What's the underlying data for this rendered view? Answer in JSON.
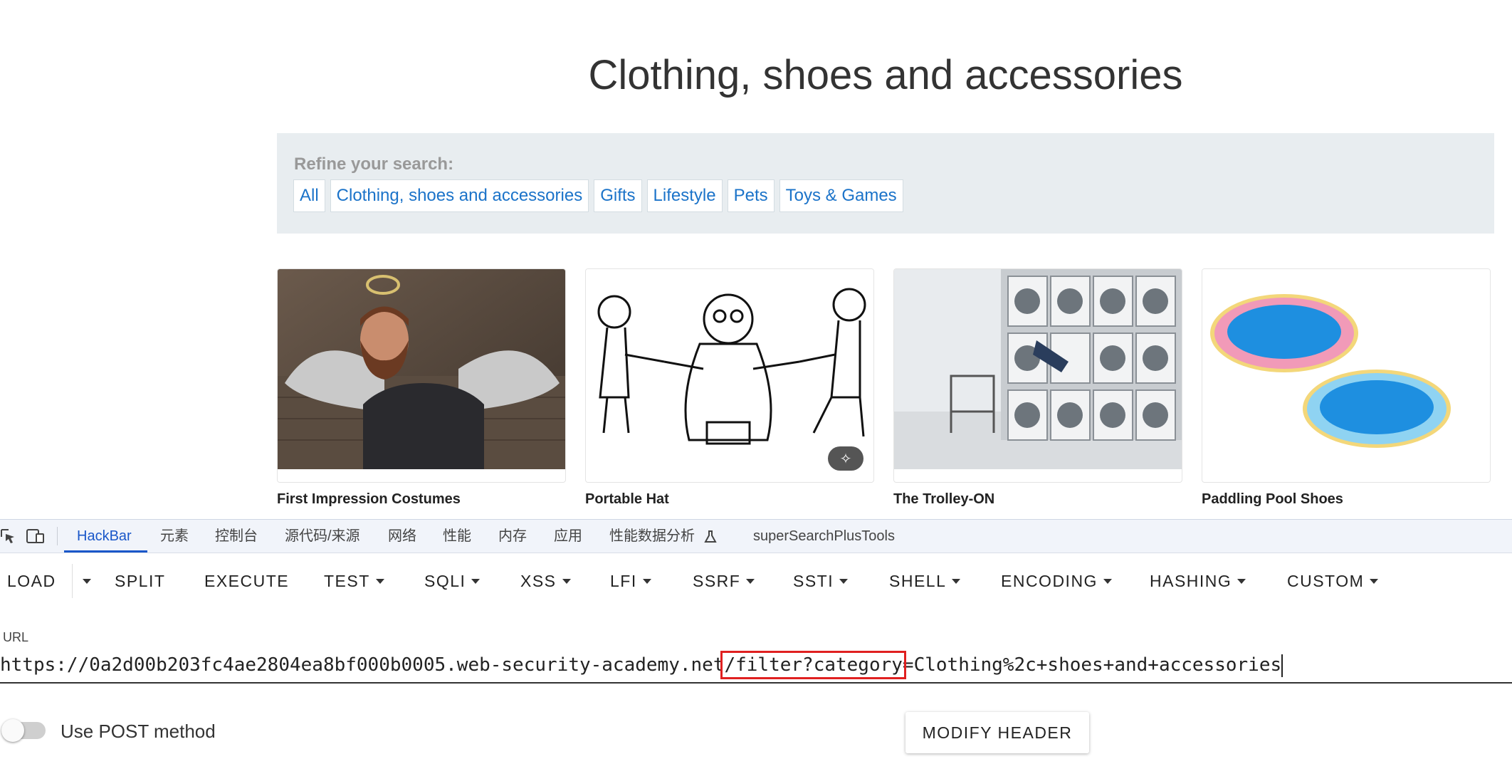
{
  "page": {
    "title": "Clothing, shoes and accessories",
    "refine_label": "Refine your search:",
    "filters": [
      "All",
      "Clothing, shoes and accessories",
      "Gifts",
      "Lifestyle",
      "Pets",
      "Toys & Games"
    ],
    "products": [
      {
        "name": "First Impression Costumes"
      },
      {
        "name": "Portable Hat"
      },
      {
        "name": "The Trolley-ON"
      },
      {
        "name": "Paddling Pool Shoes"
      }
    ]
  },
  "devtools": {
    "tabs": [
      "HackBar",
      "元素",
      "控制台",
      "源代码/来源",
      "网络",
      "性能",
      "内存",
      "应用",
      "性能数据分析",
      "superSearchPlusTools"
    ],
    "active_tab": "HackBar",
    "toolbar": [
      "LOAD",
      "SPLIT",
      "EXECUTE",
      "TEST",
      "SQLI",
      "XSS",
      "LFI",
      "SSRF",
      "SSTI",
      "SHELL",
      "ENCODING",
      "HASHING",
      "CUSTOM"
    ],
    "url_label": "URL",
    "url_prefix": "https://0a2d00b203fc4ae2804ea8bf000b0005.web-security-academy.net",
    "url_highlight": "/filter?category",
    "url_suffix": "=Clothing%2c+shoes+and+accessories",
    "post_label": "Use POST method",
    "modify_header": "MODIFY HEADER"
  },
  "colors": {
    "accent": "#1a57c9",
    "link": "#1b73c9",
    "highlight_box": "#e02020"
  }
}
